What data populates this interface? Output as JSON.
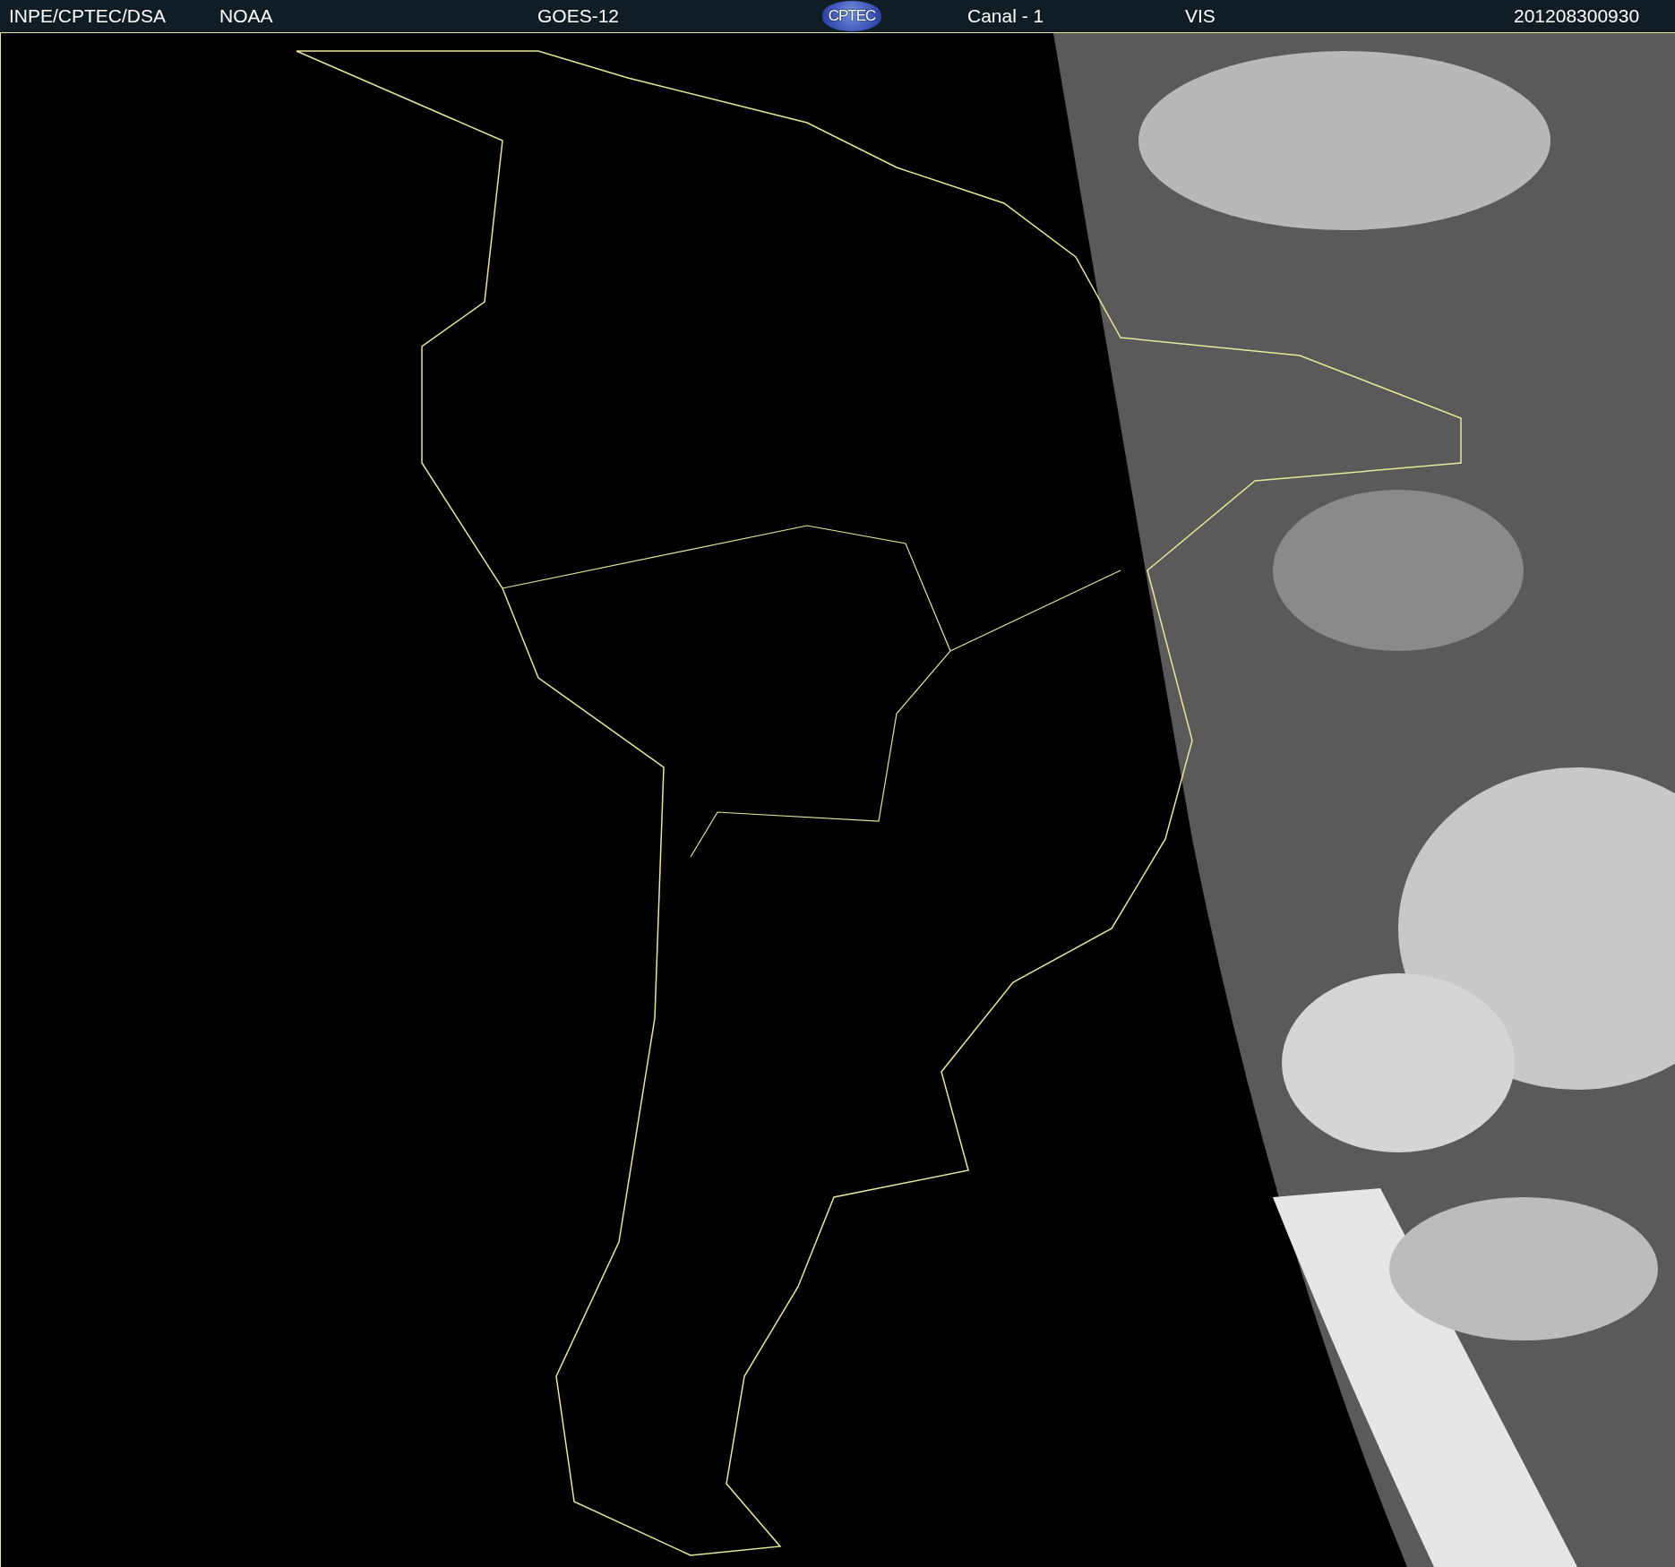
{
  "header": {
    "source": "INPE/CPTEC/DSA",
    "agency": "NOAA",
    "satellite": "GOES-12",
    "logo": "CPTEC",
    "channel": "Canal - 1",
    "band": "VIS",
    "timestamp": "201208300930"
  }
}
